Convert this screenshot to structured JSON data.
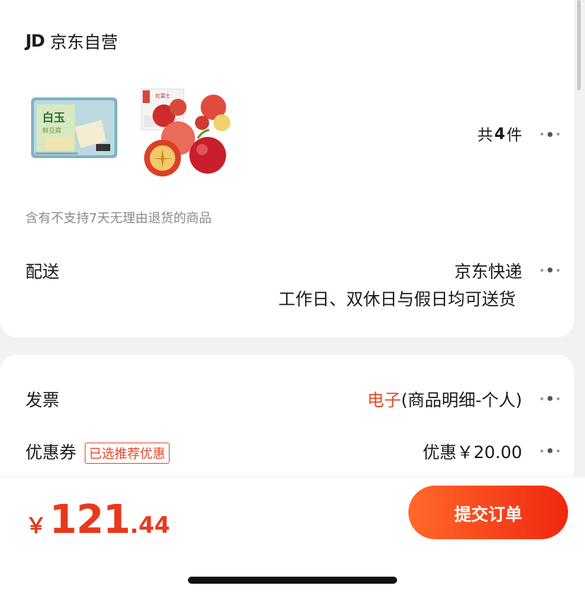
{
  "shop": {
    "logo": "JD",
    "name": "京东自营"
  },
  "items": {
    "count_prefix": "共",
    "count": "4",
    "count_suffix": "件",
    "products": [
      {
        "name": "白玉",
        "subname": "鲜豆腐"
      },
      {
        "name": "红富士"
      }
    ]
  },
  "notice": "含有不支持7天无理由退货的商品",
  "delivery": {
    "label": "配送",
    "carrier": "京东快递",
    "schedule": "工作日、双休日与假日均可送货"
  },
  "invoice": {
    "label": "发票",
    "type": "电子",
    "detail": "(商品明细-个人)"
  },
  "coupon": {
    "label": "优惠券",
    "tag": "已选推荐优惠",
    "discount": "优惠￥20.00"
  },
  "total": {
    "currency": "￥",
    "integer": "121",
    "decimal": ".44"
  },
  "submit_label": "提交订单",
  "colors": {
    "accent": "#e2492a",
    "button_start": "#ff6a2a",
    "button_end": "#f0270f"
  }
}
